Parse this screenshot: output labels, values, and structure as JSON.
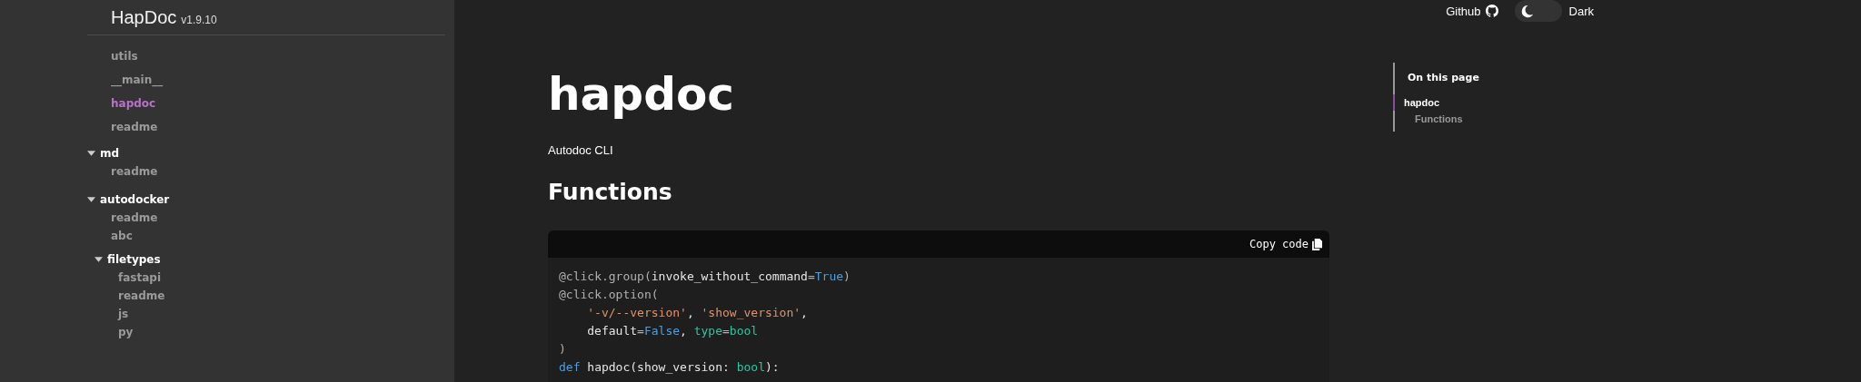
{
  "sidebar": {
    "title": "HapDoc",
    "version": "v1.9.10",
    "items": [
      {
        "kind": "page",
        "label": "utils",
        "selected": false
      },
      {
        "kind": "page",
        "label": "__main__",
        "selected": false
      },
      {
        "kind": "page",
        "label": "hapdoc",
        "selected": true
      },
      {
        "kind": "page",
        "label": "readme",
        "selected": false
      },
      {
        "kind": "group",
        "label": "md",
        "expanded": true,
        "children": [
          {
            "kind": "page",
            "label": "readme",
            "selected": false
          }
        ]
      },
      {
        "kind": "group",
        "label": "autodocker",
        "expanded": true,
        "children": [
          {
            "kind": "page",
            "label": "readme",
            "selected": false
          },
          {
            "kind": "page",
            "label": "abc",
            "selected": false
          },
          {
            "kind": "group",
            "label": "filetypes",
            "expanded": true,
            "children": [
              {
                "kind": "page",
                "label": "fastapi",
                "selected": false
              },
              {
                "kind": "page",
                "label": "readme",
                "selected": false
              },
              {
                "kind": "page",
                "label": "js",
                "selected": false
              },
              {
                "kind": "page",
                "label": "py",
                "selected": false
              }
            ]
          }
        ]
      }
    ]
  },
  "topbar": {
    "github_link": "Github",
    "theme_toggle": {
      "on": false
    },
    "theme_label": "Dark"
  },
  "article": {
    "title": "hapdoc",
    "description": "Autodoc CLI",
    "section_heading": "Functions",
    "code_block": {
      "copy_button": "Copy code",
      "lines": [
        [
          {
            "kind": "decorator",
            "text": "@click.group("
          },
          {
            "kind": "plain",
            "text": "invoke_without_command"
          },
          {
            "kind": "punct",
            "text": "="
          },
          {
            "kind": "constant",
            "text": "True"
          },
          {
            "kind": "punct",
            "text": ")"
          }
        ],
        [
          {
            "kind": "decorator",
            "text": "@click.option("
          }
        ],
        [
          {
            "kind": "indent"
          },
          {
            "kind": "string",
            "text": "'-v/--version'"
          },
          {
            "kind": "plain",
            "text": ", "
          },
          {
            "kind": "string",
            "text": "'show_version'"
          },
          {
            "kind": "plain",
            "text": ","
          }
        ],
        [
          {
            "kind": "indent"
          },
          {
            "kind": "plain",
            "text": "default"
          },
          {
            "kind": "punct",
            "text": "="
          },
          {
            "kind": "constant",
            "text": "False"
          },
          {
            "kind": "plain",
            "text": ", "
          },
          {
            "kind": "type",
            "text": "type"
          },
          {
            "kind": "punct",
            "text": "="
          },
          {
            "kind": "type",
            "text": "bool"
          }
        ],
        [
          {
            "kind": "punct",
            "text": ")"
          }
        ],
        [
          {
            "kind": "keyword",
            "text": "def"
          },
          {
            "kind": "plain",
            "text": " hapdoc(show_version: "
          },
          {
            "kind": "type",
            "text": "bool"
          },
          {
            "kind": "plain",
            "text": "):"
          }
        ]
      ]
    }
  },
  "toc": {
    "heading": "On this page",
    "items": [
      {
        "label": "hapdoc",
        "selected": true,
        "children": [
          {
            "label": "Functions",
            "selected": false
          }
        ]
      }
    ]
  }
}
